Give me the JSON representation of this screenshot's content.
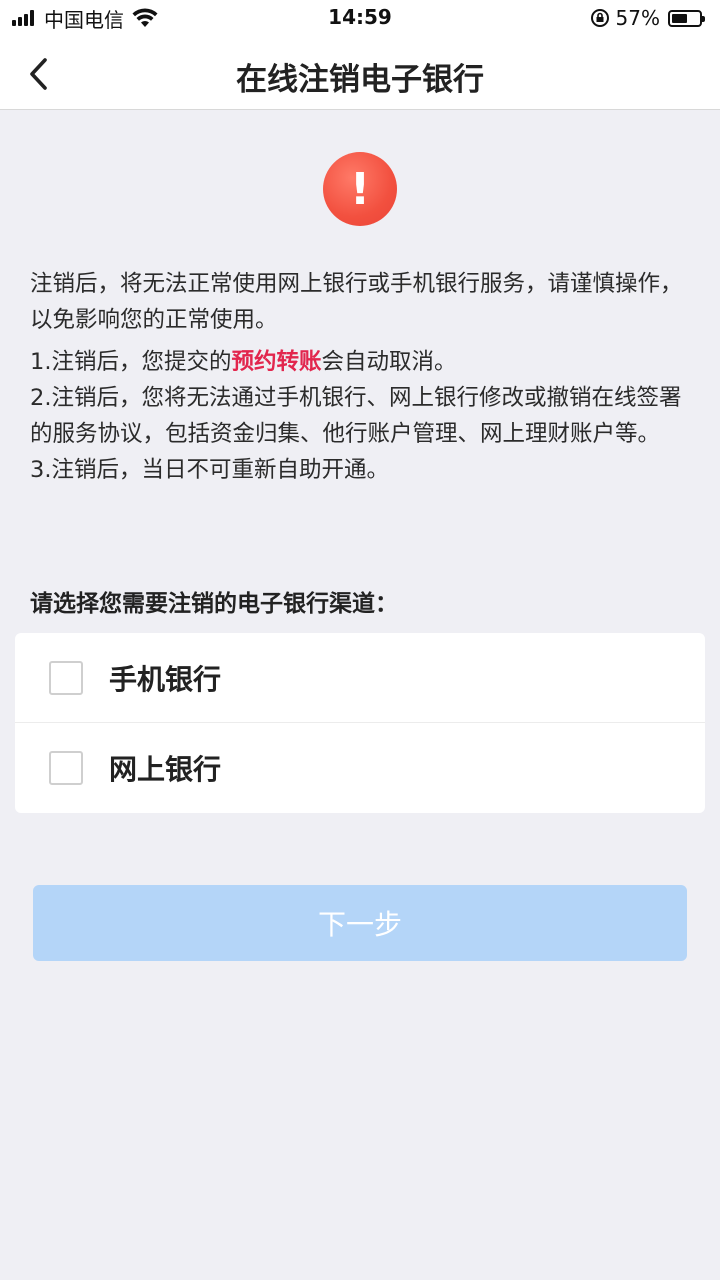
{
  "status_bar": {
    "carrier": "中国电信",
    "time": "14:59",
    "battery_percent": "57%",
    "battery_level": 0.57
  },
  "nav": {
    "title": "在线注销电子银行",
    "back_icon": "chevron-left-icon"
  },
  "alert": {
    "icon": "exclamation-icon",
    "symbol": "!",
    "color": "#f2503f"
  },
  "notice": {
    "intro": "注销后，将无法正常使用网上银行或手机银行服务，请谨慎操作，以免影响您的正常使用。",
    "item1_prefix": "1.注销后，您提交的",
    "item1_highlight": "预约转账",
    "item1_suffix": "会自动取消。",
    "item2": "2.注销后，您将无法通过手机银行、网上银行修改或撤销在线签署的服务协议，包括资金归集、他行账户管理、网上理财账户等。",
    "item3": "3.注销后，当日不可重新自助开通。",
    "highlight_color": "#e2264d"
  },
  "selection": {
    "label": "请选择您需要注销的电子银行渠道：",
    "options": [
      {
        "label": "手机银行",
        "checked": false
      },
      {
        "label": "网上银行",
        "checked": false
      }
    ]
  },
  "actions": {
    "next_label": "下一步",
    "next_color": "#b4d5f8"
  }
}
